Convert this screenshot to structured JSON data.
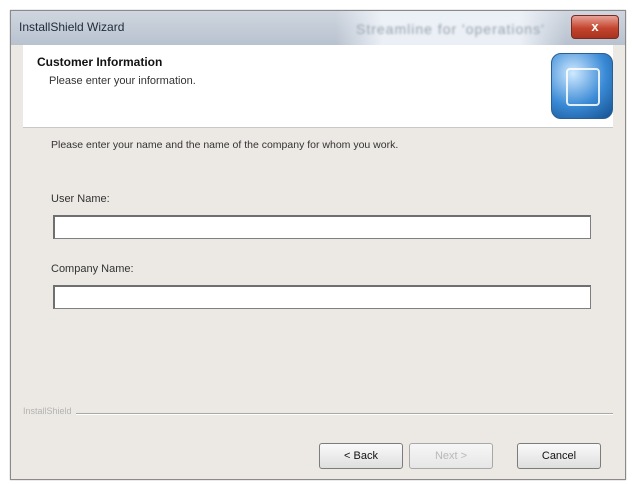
{
  "window": {
    "title": "InstallShield Wizard",
    "background_title": "Streamline for 'operations'",
    "close_label": "x"
  },
  "header": {
    "heading": "Customer Information",
    "subtitle": "Please enter your information."
  },
  "body": {
    "instruction": "Please enter your name and the name of the company for whom you work.",
    "user_name_label": "User Name:",
    "user_name_value": "",
    "company_name_label": "Company Name:",
    "company_name_value": ""
  },
  "footer": {
    "brand": "InstallShield",
    "back_label": "< Back",
    "next_label": "Next >",
    "cancel_label": "Cancel"
  }
}
